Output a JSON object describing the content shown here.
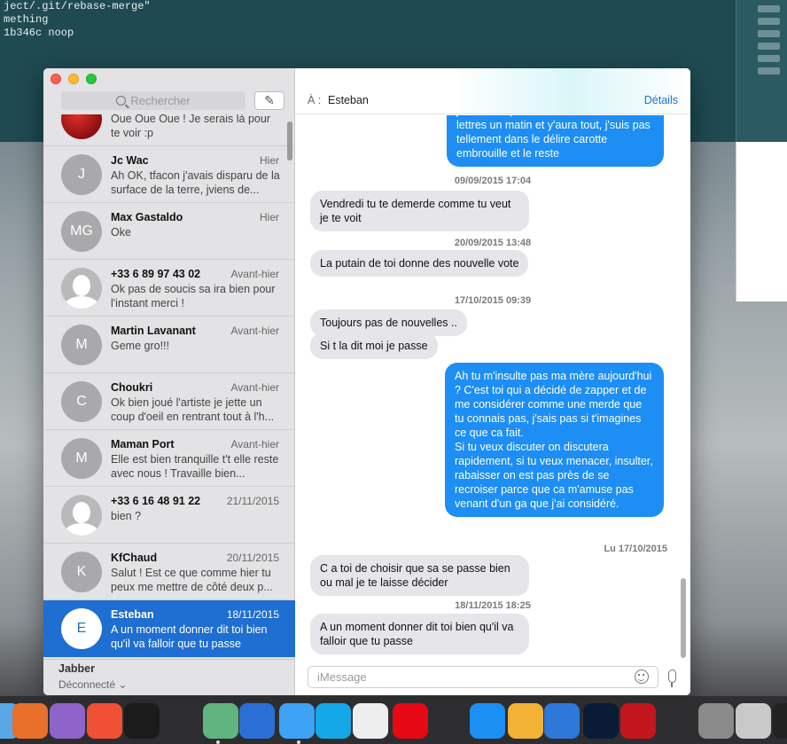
{
  "terminal": {
    "lines": [
      "ject/.git/rebase-merge\"",
      "mething",
      "",
      "",
      "1b346c noop"
    ]
  },
  "sidebar": {
    "search_placeholder": "Rechercher",
    "conversations": [
      {
        "name": "",
        "date": "",
        "preview": "Oue Oue Oue ! Je serais là pour te voir :p",
        "avatar": "",
        "avatar_type": "photo"
      },
      {
        "name": "Jc Wac",
        "date": "Hier",
        "preview": "Ah OK, tfacon j'avais disparu de la surface de la terre, jviens de...",
        "avatar": "J",
        "avatar_type": "initial"
      },
      {
        "name": "Max Gastaldo",
        "date": "Hier",
        "preview": "Oke",
        "avatar": "MG",
        "avatar_type": "initial"
      },
      {
        "name": "+33 6 89 97 43 02",
        "date": "Avant-hier",
        "preview": "Ok pas de soucis sa ira bien pour l'instant merci !",
        "avatar": "",
        "avatar_type": "silhouette"
      },
      {
        "name": "Martin Lavanant",
        "date": "Avant-hier",
        "preview": "Geme gro!!!",
        "avatar": "M",
        "avatar_type": "initial"
      },
      {
        "name": "Choukri",
        "date": "Avant-hier",
        "preview": "Ok bien joué l'artiste je jette un coup d'oeil en rentrant tout à l'h...",
        "avatar": "C",
        "avatar_type": "initial"
      },
      {
        "name": "Maman Port",
        "date": "Avant-hier",
        "preview": "Elle est bien tranquille t't elle reste avec nous ! Travaille bien...",
        "avatar": "M",
        "avatar_type": "initial"
      },
      {
        "name": "+33 6 16 48 91 22",
        "date": "21/11/2015",
        "preview": "bien ?",
        "avatar": "",
        "avatar_type": "silhouette"
      },
      {
        "name": "KfChaud",
        "date": "20/11/2015",
        "preview": "Salut ! Est ce que comme hier tu peux me mettre de côté deux p...",
        "avatar": "K",
        "avatar_type": "initial"
      },
      {
        "name": "Esteban",
        "date": "18/11/2015",
        "preview": "A un moment donner dit toi bien qu'il va falloir que tu passe",
        "avatar": "E",
        "avatar_type": "initial",
        "selected": true
      }
    ],
    "footer": {
      "account": "Jabber",
      "status": "Déconnecté ⌄"
    }
  },
  "chat": {
    "to_label": "À :",
    "to_name": "Esteban",
    "details_label": "Détails",
    "input_placeholder": "iMessage",
    "items": [
      {
        "kind": "out",
        "text": "j'attends à peine t'ouvrira ta boite aux lettres un matin et y'aura tout, j'suis pas tellement dans le délire carotte embrouille et le reste"
      },
      {
        "kind": "stamp",
        "text": "09/09/2015 17:04"
      },
      {
        "kind": "in",
        "text": "Vendredi tu te demerde comme tu veut je te voit"
      },
      {
        "kind": "stamp",
        "text": "20/09/2015 13:48"
      },
      {
        "kind": "in",
        "text": "La putain de toi donne des nouvelle vote"
      },
      {
        "kind": "stamp",
        "text": "17/10/2015 09:39"
      },
      {
        "kind": "in",
        "text": "Toujours pas de nouvelles .."
      },
      {
        "kind": "in",
        "text": "Si t la dit moi je passe"
      },
      {
        "kind": "out",
        "text": "Ah tu m'insulte pas ma mère aujourd'hui ? C'est toi qui a décidé de zapper et de me considérer comme une merde que tu connais pas, j'sais pas si t'imagines ce que ca fait.\nSi tu veux discuter on discutera rapidement, si tu veux menacer, insulter, rabaisser on est pas près de se recroiser parce que ca m'amuse pas venant d'un ga que j'ai considéré."
      },
      {
        "kind": "stamp",
        "text": "Lu 17/10/2015"
      },
      {
        "kind": "in",
        "text": "C a toi de choisir que sa se passe bien ou mal je te laisse décider"
      },
      {
        "kind": "stamp",
        "text": "18/11/2015 18:25"
      },
      {
        "kind": "in",
        "text": "A un moment donner dit toi bien qu'il va falloir que tu passe"
      }
    ]
  },
  "dock": {
    "items": [
      {
        "icon": "finder-icon",
        "color": "#5aa7e8"
      },
      {
        "icon": "firefox-icon",
        "color": "#e8702a"
      },
      {
        "icon": "github-icon",
        "color": "#8f64c9"
      },
      {
        "icon": "swift-icon",
        "color": "#f05033"
      },
      {
        "icon": "fox-icon",
        "color": "#1b1b1b"
      },
      {
        "icon": "atom-icon",
        "color": "#5fb57d"
      },
      {
        "icon": "thunderbird-icon",
        "color": "#2b6fd6"
      },
      {
        "icon": "messages-icon",
        "color": "#3ea2f4"
      },
      {
        "icon": "skype-icon",
        "color": "#14a8e8"
      },
      {
        "icon": "sublime-icon",
        "color": "#eeeeee"
      },
      {
        "icon": "netflix-icon",
        "color": "#e50914"
      },
      {
        "icon": "app-store-icon",
        "color": "#1b8ff2"
      },
      {
        "icon": "photos-icon",
        "color": "#f2b233"
      },
      {
        "icon": "xcode-icon",
        "color": "#2d78d8"
      },
      {
        "icon": "photoshop-icon",
        "color": "#0a1b35"
      },
      {
        "icon": "filezilla-icon",
        "color": "#c3151d"
      },
      {
        "icon": "system-preferences-icon",
        "color": "#8a8a8a"
      },
      {
        "icon": "trash-icon",
        "color": "#c9c9c9"
      },
      {
        "icon": "terminal-icon",
        "color": "#222"
      }
    ]
  }
}
